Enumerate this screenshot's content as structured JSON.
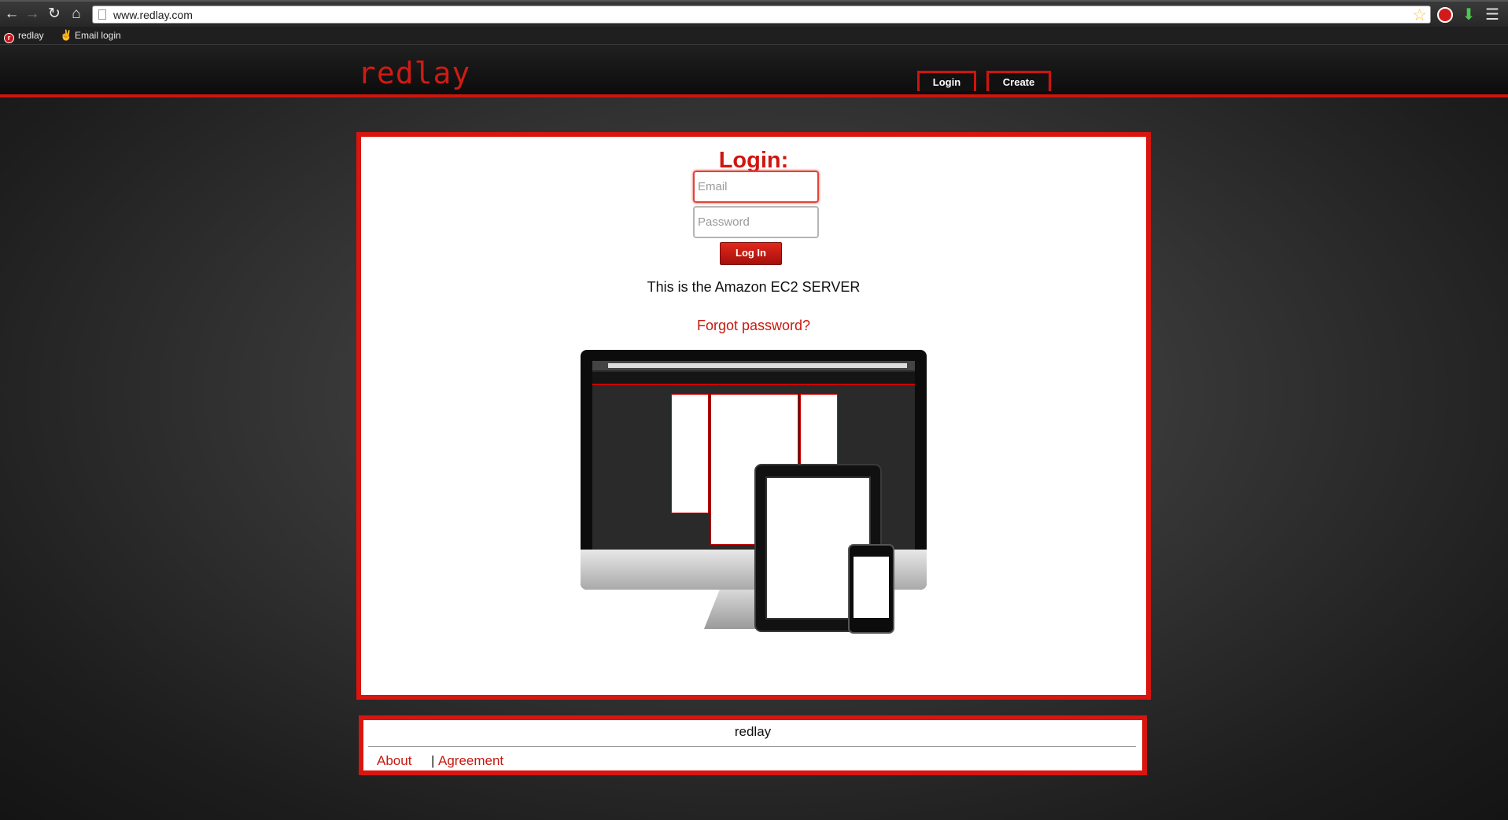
{
  "browser": {
    "url": "www.redlay.com",
    "bookmarks": [
      {
        "label": "redlay",
        "icon": "redlay-favicon"
      },
      {
        "label": "Email login",
        "icon": "hand-icon"
      }
    ],
    "nav_icons": [
      "back-arrow-icon",
      "forward-arrow-icon",
      "reload-icon",
      "home-icon"
    ]
  },
  "site": {
    "logo": "redlay",
    "header_buttons": {
      "login": "Login",
      "create": "Create"
    },
    "accent_color": "#d0140e"
  },
  "login": {
    "title": "Login:",
    "email_placeholder": "Email",
    "password_placeholder": "Password",
    "submit_label": "Log In",
    "server_note": "This is the Amazon EC2 SERVER",
    "forgot_link": "Forgot password?"
  },
  "footer": {
    "title": "redlay",
    "links": {
      "about": "About",
      "separator": "|",
      "agreement": "Agreement"
    }
  }
}
